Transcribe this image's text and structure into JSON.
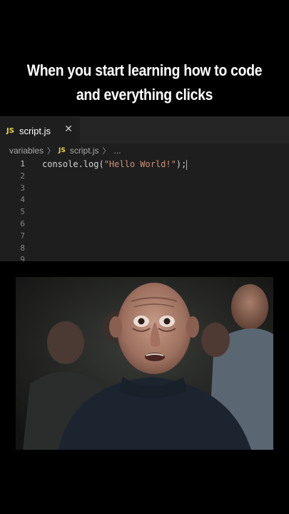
{
  "caption": {
    "line1": "When you start learning how to code",
    "line2": "and everything clicks"
  },
  "editor": {
    "tab": {
      "badge": "JS",
      "filename": "script.js",
      "close_icon": "close-icon"
    },
    "breadcrumb": {
      "folder": "variables",
      "badge": "JS",
      "file": "script.js",
      "more": "..."
    },
    "line_numbers": [
      "1",
      "2",
      "3",
      "4",
      "5",
      "6",
      "7",
      "8",
      "9"
    ],
    "code": {
      "fn": "console.log(",
      "str": "\"Hello World!\"",
      "end": ");"
    },
    "colors": {
      "background": "#1e1e1e",
      "tabbar": "#252526",
      "js_badge": "#e8d44d",
      "string": "#ce9178"
    }
  },
  "scene": {
    "description_icon": "reaction-image"
  }
}
